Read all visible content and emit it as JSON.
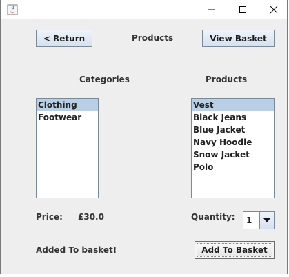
{
  "titlebar": {
    "icons": [
      "java-app-icon",
      "minimize-icon",
      "maximize-icon",
      "close-icon"
    ]
  },
  "header": {
    "return_label": "< Return",
    "title": "Products",
    "view_basket_label": "View Basket"
  },
  "categories": {
    "heading": "Categories",
    "items": [
      "Clothing",
      "Footwear"
    ],
    "selected": "Clothing"
  },
  "products": {
    "heading": "Products",
    "items": [
      "Vest",
      "Black Jeans",
      "Blue Jacket",
      "Navy Hoodie",
      "Snow Jacket",
      "Polo"
    ],
    "selected": "Vest"
  },
  "price": {
    "label": "Price:",
    "value": "£30.0"
  },
  "quantity": {
    "label": "Quantity:",
    "value": "1"
  },
  "status": {
    "message": "Added To basket!"
  },
  "add_to_basket_label": "Add To Basket",
  "colors": {
    "window_bg": "#eeeeee",
    "selection_bg": "#b8cfe5",
    "button_top": "#eef3fa",
    "button_bottom": "#d5e1ef"
  }
}
